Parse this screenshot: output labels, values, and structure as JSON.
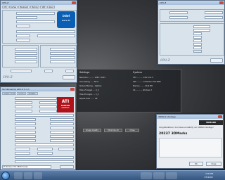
{
  "cpuz_left": {
    "title": "CPU-Z",
    "tabs": [
      "CPU",
      "Caches",
      "Mainboard",
      "Memory",
      "SPD",
      "About"
    ],
    "brand": "intel",
    "brand_sub": "Core i7",
    "footer": "CPU-Z"
  },
  "cpuz_right": {
    "title": "CPU-Z",
    "footer": "CPU-Z"
  },
  "gpuz": {
    "title": "TechPowerUp GPU-Z 0.4.1",
    "tabs": [
      "Graphics Card",
      "Sensors",
      "Validation"
    ],
    "gpu_name": "ATI Radeon HD 4890 Series",
    "brand": "ATI",
    "brand_sub": "RADEON",
    "brand_sub2": "GRAPHICS",
    "footer": "ATI Radeon HD 4890 Series"
  },
  "vantage": {
    "section1": "Settings",
    "section2": "System",
    "btn_image_quality": "Image Quality",
    "btn_minimize": "Minimize All",
    "btn_close": "Close"
  },
  "result": {
    "title": "3DMark Vantage",
    "brand": "3DMARK",
    "message": "Congratulations, You have succesfully run 3DMark Vantage!",
    "score": "20237 3DMarks",
    "btn_ok": "OK",
    "btn_close": "Close"
  },
  "taskbar": {
    "time": "4:00 PM",
    "date": "7/5/2009"
  },
  "colors": {
    "desktop": "#3a3c40",
    "titlebar": "#a5bedb",
    "taskbar": "#34557e",
    "intel_blue": "#0a5fb4",
    "ati_red": "#b0121a"
  }
}
